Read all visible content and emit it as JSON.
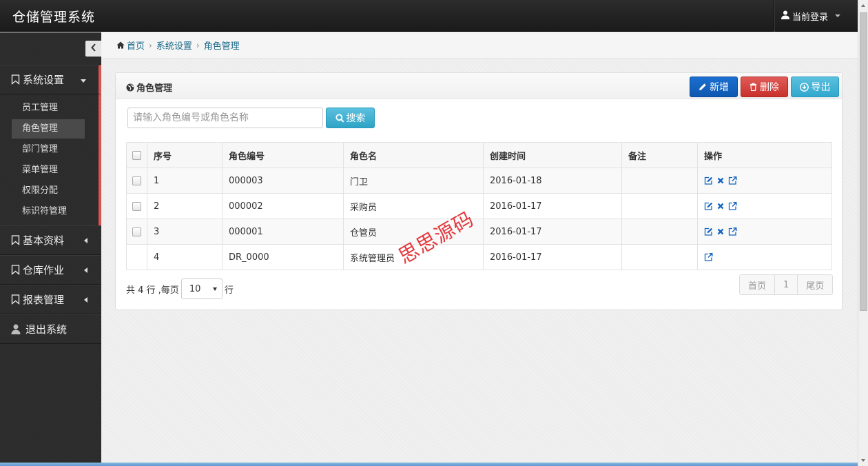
{
  "app": {
    "title": "仓储管理系统",
    "user_menu": "当前登录"
  },
  "sidebar": {
    "groups": [
      {
        "label": "系统设置",
        "icon": "bookmark-icon",
        "open": true,
        "items": [
          {
            "label": "员工管理"
          },
          {
            "label": "角色管理",
            "active": true
          },
          {
            "label": "部门管理"
          },
          {
            "label": "菜单管理"
          },
          {
            "label": "权限分配"
          },
          {
            "label": "标识符管理"
          }
        ]
      },
      {
        "label": "基本资料",
        "icon": "bookmark-icon"
      },
      {
        "label": "仓库作业",
        "icon": "bookmark-icon"
      },
      {
        "label": "报表管理",
        "icon": "bookmark-icon"
      },
      {
        "label": "退出系统",
        "icon": "user-icon"
      }
    ]
  },
  "breadcrumb": {
    "home": "首页",
    "section": "系统设置",
    "current": "角色管理"
  },
  "panel": {
    "title": "角色管理",
    "buttons": {
      "add": "新增",
      "delete": "删除",
      "export": "导出"
    },
    "search": {
      "placeholder": "请输入角色编号或角色名称",
      "value": "",
      "button": "搜索"
    }
  },
  "table": {
    "headers": {
      "index": "序号",
      "code": "角色编号",
      "name": "角色名",
      "created": "创建时间",
      "remark": "备注",
      "actions": "操作"
    },
    "rows": [
      {
        "index": "1",
        "code": "000003",
        "name": "门卫",
        "created": "2016-01-18",
        "remark": ""
      },
      {
        "index": "2",
        "code": "000002",
        "name": "采购员",
        "created": "2016-01-17",
        "remark": ""
      },
      {
        "index": "3",
        "code": "000001",
        "name": "仓管员",
        "created": "2016-01-17",
        "remark": ""
      },
      {
        "index": "4",
        "code": "DR_0000",
        "name": "系统管理员",
        "created": "2016-01-17",
        "remark": ""
      }
    ]
  },
  "footer": {
    "prefix": "共 4 行 ,每页",
    "per_page": "10",
    "suffix": "行"
  },
  "pager": {
    "first": "首页",
    "page": "1",
    "last": "尾页"
  },
  "watermark": "思思源码",
  "colors": {
    "add": "#1565c0",
    "delete": "#d9534f",
    "export": "#5bc0de",
    "link": "#1a6a8a",
    "sidebar_accent": "#d9534f"
  }
}
